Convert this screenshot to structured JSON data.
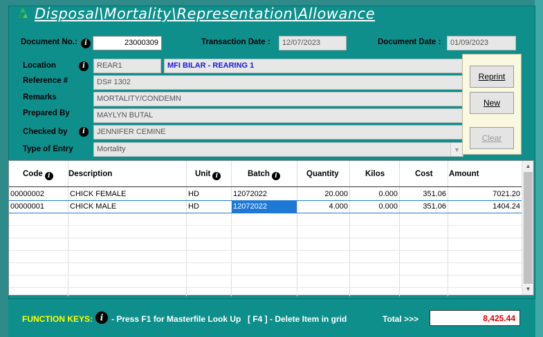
{
  "window": {
    "title": "Disposal\\Mortality\\Representation\\Allowance"
  },
  "header": {
    "document_no_label": "Document No.:",
    "document_no": "23000309",
    "transaction_date_label": "Transaction Date :",
    "transaction_date": "12/07/2023",
    "document_date_label": "Document Date :",
    "document_date": "01/09/2023"
  },
  "form": {
    "location_label": "Location",
    "location_code": "REAR1",
    "location_name": "MFI BILAR - REARING 1",
    "reference_label": "Reference #",
    "reference": "DS# 1302",
    "remarks_label": "Remarks",
    "remarks": "MORTALITY/CONDEMN",
    "prepared_by_label": "Prepared By",
    "prepared_by": "MAYLYN BUTAL",
    "checked_by_label": "Checked by",
    "checked_by": "JENNIFER CEMINE",
    "type_of_entry_label": "Type of Entry",
    "type_of_entry": "Mortality"
  },
  "buttons": {
    "reprint": "Reprint",
    "new": "New",
    "clear": "Clear"
  },
  "grid": {
    "columns": [
      "Code",
      "Description",
      "Unit",
      "Batch",
      "Quantity",
      "Kilos",
      "Cost",
      "Amount"
    ],
    "rows": [
      {
        "code": "00000002",
        "description": "CHICK FEMALE",
        "unit": "HD",
        "batch": "12072022",
        "quantity": "20.000",
        "kilos": "0.000",
        "cost": "351.06",
        "amount": "7021.20"
      },
      {
        "code": "00000001",
        "description": "CHICK MALE",
        "unit": "HD",
        "batch": "12072022",
        "quantity": "4.000",
        "kilos": "0.000",
        "cost": "351.06",
        "amount": "1404.24"
      }
    ]
  },
  "footer": {
    "function_keys_label": "FUNCTION KEYS:",
    "hint_f1": "- Press F1 for Masterfile Look Up",
    "hint_f4": "[ F4 ] - Delete Item in grid",
    "total_label": "Total >>>",
    "total": "8,425.44"
  },
  "icons": {
    "logo": "recycle-icon",
    "info": "info-icon"
  },
  "colors": {
    "background": "#0e8f8c",
    "title_text": "#ffffff",
    "location_name": "#1a1ad6",
    "function_keys": "#ffff00",
    "total_value": "#e00000",
    "selected_cell": "#1e78d6"
  }
}
